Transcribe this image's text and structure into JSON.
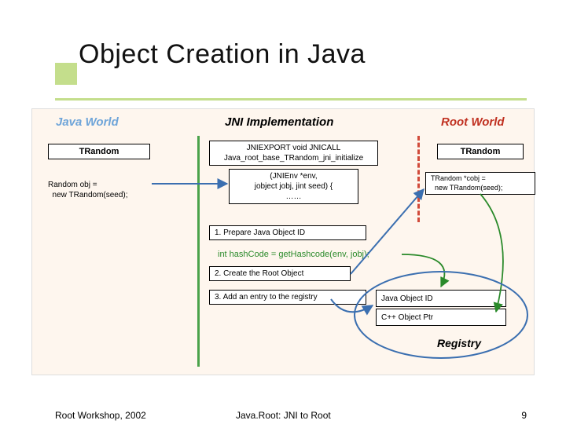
{
  "title": "Object Creation in Java",
  "columns": {
    "java": "Java World",
    "jni": "JNI Implementation",
    "root": "Root World"
  },
  "java": {
    "class_box": "TRandom",
    "code": "Random obj =\n  new TRandom(seed);"
  },
  "jni": {
    "sig": "JNIEXPORT void JNICALL\nJava_root_base_TRandom_jni_initialize",
    "args": "(JNIEnv *env,\njobject jobj, jint seed) {\n……",
    "step1": "1. Prepare Java Object ID",
    "hash": "int hashCode = getHashcode(env, jobj);",
    "step2": "2. Create the Root Object",
    "step3": "3. Add an entry to the registry"
  },
  "root": {
    "class_box": "TRandom",
    "code": "TRandom *cobj =\n  new TRandom(seed);"
  },
  "registry": {
    "col1": "Java Object ID",
    "col2": "C++ Object Ptr",
    "label": "Registry"
  },
  "footer": {
    "left": "Root Workshop, 2002",
    "center": "Java.Root: JNI to Root",
    "right": "9"
  }
}
